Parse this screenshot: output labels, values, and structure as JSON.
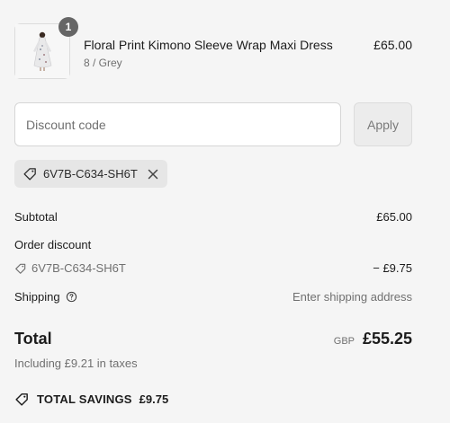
{
  "cart": {
    "item": {
      "name": "Floral Print Kimono Sleeve Wrap Maxi Dress",
      "variant": "8 / Grey",
      "price": "£65.00",
      "quantity": "1"
    }
  },
  "discount": {
    "placeholder": "Discount code",
    "value": "",
    "apply_label": "Apply",
    "applied_code": "6V7B-C634-SH6T"
  },
  "summary": {
    "subtotal_label": "Subtotal",
    "subtotal_value": "£65.00",
    "order_discount_label": "Order discount",
    "discount_code": "6V7B-C634-SH6T",
    "discount_value": "− £9.75",
    "shipping_label": "Shipping",
    "shipping_value": "Enter shipping address",
    "total_label": "Total",
    "currency": "GBP",
    "total_value": "£55.25",
    "taxes_note": "Including £9.21 in taxes",
    "savings_label": "TOTAL SAVINGS",
    "savings_value": "£9.75"
  },
  "icons": {
    "tag": "tag-icon",
    "close": "close-icon",
    "help": "help-icon"
  },
  "colors": {
    "background": "#f5f5f5",
    "text": "#1c1c1c",
    "muted": "#707070",
    "badge": "#666666"
  }
}
